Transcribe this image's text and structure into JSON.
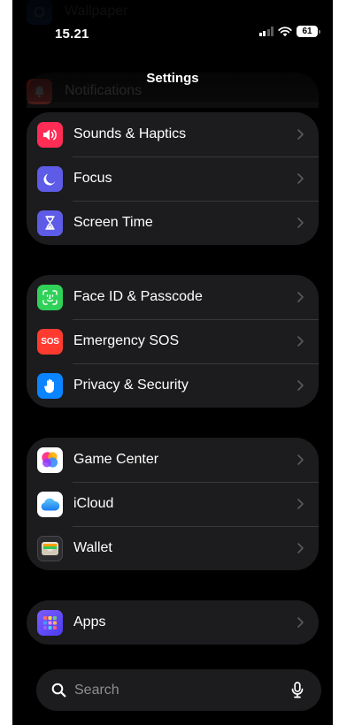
{
  "status_bar": {
    "time": "15.21",
    "battery": "61"
  },
  "nav": {
    "title": "Settings"
  },
  "ghost_rows": [
    {
      "label": "Wallpaper",
      "icon": "wallpaper-icon",
      "color": "#2f6fd8"
    },
    {
      "label": "Notifications",
      "icon": "bell-icon",
      "color": "#ff3b30"
    }
  ],
  "groups": [
    {
      "items": [
        {
          "label": "Sounds & Haptics",
          "icon": "speaker-icon",
          "color": "#ff2d55"
        },
        {
          "label": "Focus",
          "icon": "moon-icon",
          "color": "#5e5ce6"
        },
        {
          "label": "Screen Time",
          "icon": "hourglass-icon",
          "color": "#5e5ce6"
        }
      ]
    },
    {
      "items": [
        {
          "label": "Face ID & Passcode",
          "icon": "face-id-icon",
          "color": "#30d158"
        },
        {
          "label": "Emergency SOS",
          "icon": "sos-icon",
          "color": "#ff3b30",
          "icon_text": "SOS"
        },
        {
          "label": "Privacy & Security",
          "icon": "hand-icon",
          "color": "#0a84ff"
        }
      ]
    },
    {
      "items": [
        {
          "label": "Game Center",
          "icon": "game-center-icon",
          "color": "#ffffff"
        },
        {
          "label": "iCloud",
          "icon": "cloud-icon",
          "color": "#ffffff"
        },
        {
          "label": "Wallet",
          "icon": "wallet-icon",
          "color": "#1c1c1e"
        }
      ]
    },
    {
      "items": [
        {
          "label": "Apps",
          "icon": "apps-grid-icon",
          "color": "#5e5ce6"
        }
      ]
    }
  ],
  "search": {
    "placeholder": "Search"
  }
}
